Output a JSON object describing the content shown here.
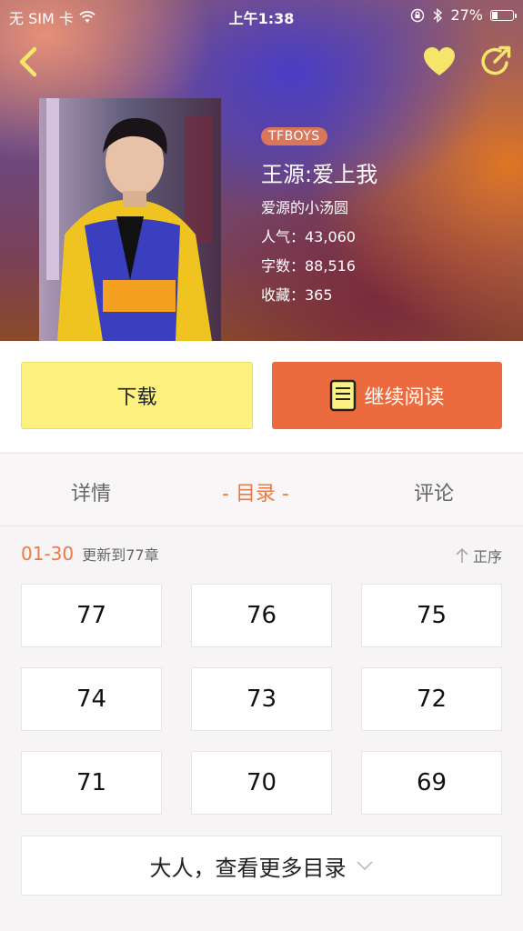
{
  "status_bar": {
    "carrier": "无 SIM 卡",
    "time": "上午1:38",
    "battery": "27%",
    "battery_level": 0.27
  },
  "nav": {
    "back_icon": "chevron-left-icon",
    "favorite_icon": "heart-icon",
    "share_icon": "share-icon",
    "icon_color": "#f5e56a"
  },
  "book": {
    "tag": "TFBOYS",
    "title": "王源:爱上我",
    "author": "爱源的小汤圆",
    "popularity": "人气：43,060",
    "word_count": "字数：88,516",
    "favorites": "收藏：365"
  },
  "actions": {
    "download": "下载",
    "continue_reading": "继续阅读",
    "download_color": "#fdf27f",
    "read_color": "#ec6b3e"
  },
  "tabs": [
    {
      "label": "详情"
    },
    {
      "label": "- 目录 -"
    },
    {
      "label": "评论"
    }
  ],
  "chapters": {
    "range": "01-30",
    "updated": "更新到77章",
    "sort": "正序",
    "items": [
      "77",
      "76",
      "75",
      "74",
      "73",
      "72",
      "71",
      "70",
      "69"
    ],
    "more": "大人，查看更多目录",
    "accent_color": "#ec7a43"
  }
}
